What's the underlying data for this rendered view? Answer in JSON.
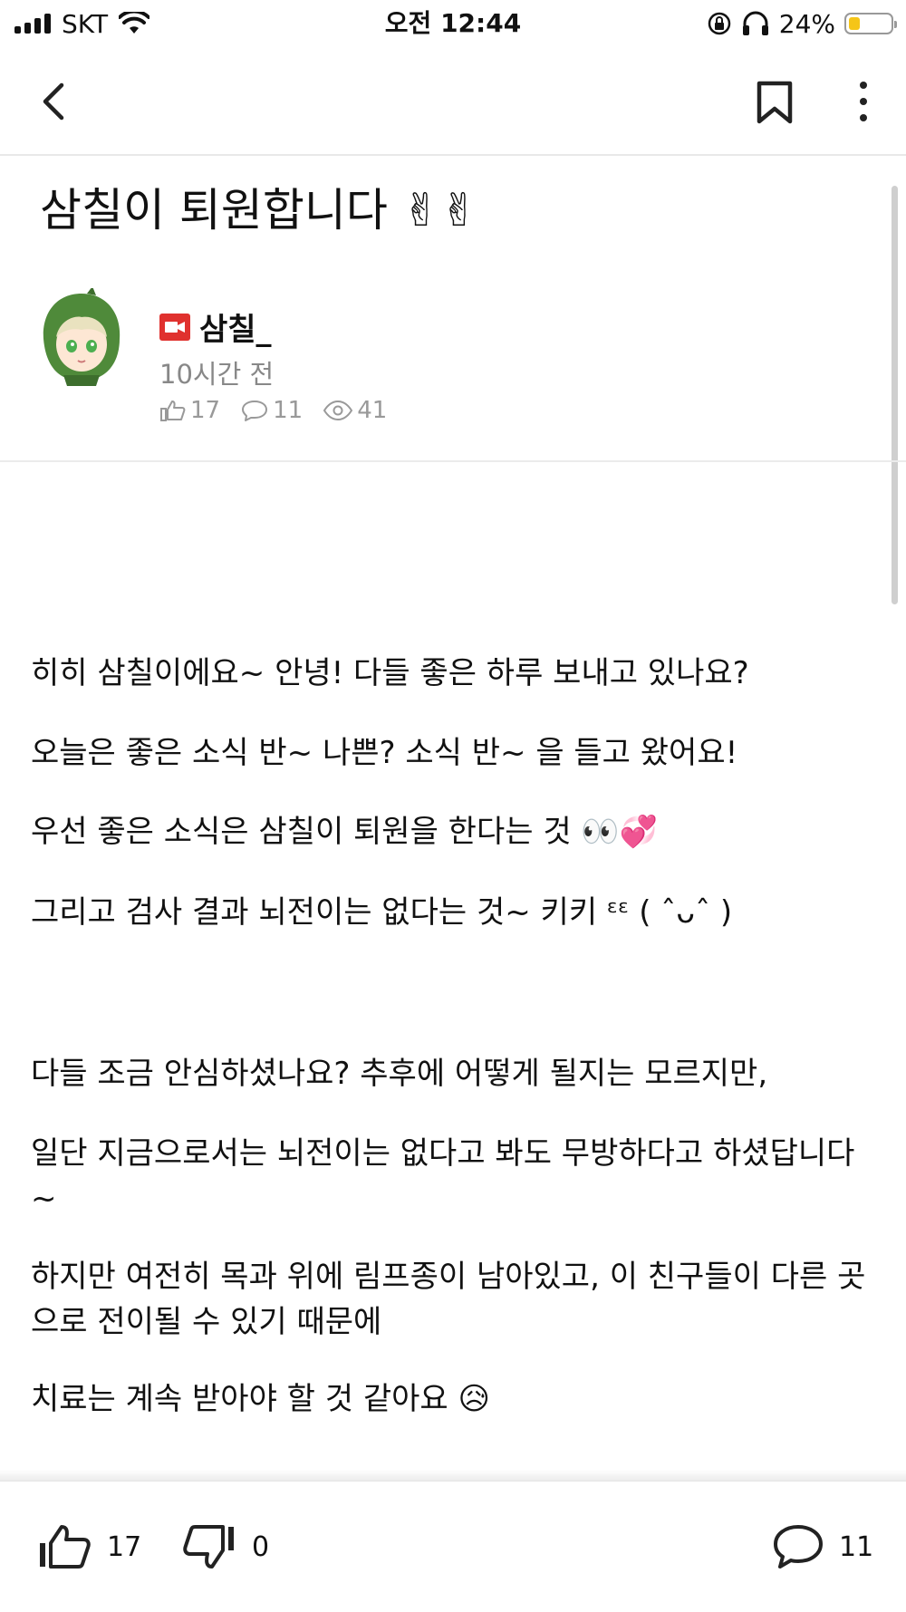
{
  "status_bar": {
    "carrier": "SKT",
    "time": "오전 12:44",
    "battery": "24%",
    "battery_level": 0.24
  },
  "nav": {
    "back_icon": "chevron-left-icon",
    "bookmark_icon": "bookmark-icon",
    "more_icon": "more-vertical-icon"
  },
  "post": {
    "title": "삼칠이 퇴원합니다 ✌✌",
    "author": "삼칠_",
    "time": "10시간 전",
    "likes": "17",
    "comments": "11",
    "views": "41"
  },
  "body": {
    "p1": "히히 삼칠이에요~ 안녕! 다들 좋은 하루 보내고 있나요?",
    "p2": "오늘은 좋은 소식 반~ 나쁜? 소식 반~ 을 들고 왔어요!",
    "p3": "우선 좋은 소식은 삼칠이 퇴원을 한다는 것 👀💞",
    "p4": "그리고 검사 결과 뇌전이는 없다는 것~ 키키 ᵋᵋ ( ˆᴗˆ )",
    "p5": "다들 조금 안심하셨나요? 추후에 어떻게 될지는 모르지만,",
    "p6": "일단 지금으로서는 뇌전이는 없다고 봐도 무방하다고 하셨답니다~",
    "p7": "하지만 여전히 목과 위에 림프종이 남아있고, 이 친구들이 다른 곳으로 전이될 수 있기 때문에",
    "p8": "치료는 계속 받아야 할 것 같아요 😥"
  },
  "bottom_bar": {
    "like_count": "17",
    "dislike_count": "0",
    "comment_count": "11"
  },
  "colors": {
    "live_badge": "#e0312e",
    "battery_fill": "#f5c518",
    "muted_text": "#888888"
  }
}
